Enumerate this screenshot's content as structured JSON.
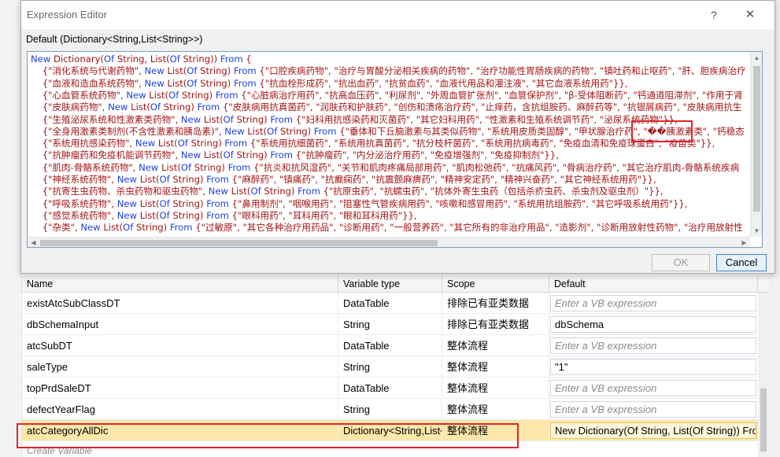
{
  "dialog": {
    "title": "Expression Editor",
    "help_label": "?",
    "close_label": "✕",
    "expression_label": "Default (Dictionary<String,List<String>>)",
    "ok_label": "OK",
    "cancel_label": "Cancel"
  },
  "code": {
    "lines": [
      [
        [
          "kw",
          "New"
        ],
        [
          "t",
          " Dictionary("
        ],
        [
          "kw",
          "Of"
        ],
        [
          "t",
          " String, List("
        ],
        [
          "kw",
          "Of"
        ],
        [
          "t",
          " String)) "
        ],
        [
          "kw",
          "From"
        ],
        [
          "t",
          " {"
        ]
      ],
      [
        [
          "t",
          "    {\"消化系统与代谢药物\", "
        ],
        [
          "kw",
          "New"
        ],
        [
          "t",
          " List("
        ],
        [
          "kw",
          "Of"
        ],
        [
          "t",
          " String) "
        ],
        [
          "kw",
          "From"
        ],
        [
          "t",
          " {\"口腔疾病药物\", \"治疗与胃酸分泌相关疾病的药物\", \"治疗功能性胃肠疾病的药物\", \"镇吐药和止呕药\", \"肝、胆疾病治疗"
        ]
      ],
      [
        [
          "t",
          "    {\"血液和造血系统药物\", "
        ],
        [
          "kw",
          "New"
        ],
        [
          "t",
          " List("
        ],
        [
          "kw",
          "Of"
        ],
        [
          "t",
          " String) "
        ],
        [
          "kw",
          "From"
        ],
        [
          "t",
          " {\"抗血栓形成药\", \"抗出血药\", \"抗贫血药\", \"血液代用品和灌注液\", \"其它血液系统用药\"}},"
        ]
      ],
      [
        [
          "t",
          "    {\"心血管系统药物\", "
        ],
        [
          "kw",
          "New"
        ],
        [
          "t",
          " List("
        ],
        [
          "kw",
          "Of"
        ],
        [
          "t",
          " String) "
        ],
        [
          "kw",
          "From"
        ],
        [
          "t",
          " {\"心脏病治疗用药\", \"抗高血压药\", \"利尿剂\", \"外周血管扩张剂\", \"血管保护剂\", \"β-受体阻断药\", \"钙通道阻滞剂\", \"作用于肾"
        ]
      ],
      [
        [
          "t",
          "    {\"皮肤病药物\", "
        ],
        [
          "kw",
          "New"
        ],
        [
          "t",
          " List("
        ],
        [
          "kw",
          "Of"
        ],
        [
          "t",
          " String) "
        ],
        [
          "kw",
          "From"
        ],
        [
          "t",
          " {\"皮肤病用抗真菌药\", \"润肤药和护肤药\", \"创伤和溃疡治疗药\", \"止痒药，含抗组胺药、麻醉药等\", \"抗银屑病药\", \"皮肤病用抗生"
        ]
      ],
      [
        [
          "t",
          "    {\"生殖泌尿系统和性激素类药物\", "
        ],
        [
          "kw",
          "New"
        ],
        [
          "t",
          " List("
        ],
        [
          "kw",
          "Of"
        ],
        [
          "t",
          " String) "
        ],
        [
          "kw",
          "From"
        ],
        [
          "t",
          " {\"妇科用抗感染药和灭菌药\", \"其它妇科用药\", \"性激素和生殖系统调节药\", \"泌尿系统药物\"}},"
        ]
      ],
      [
        [
          "t",
          "    {\"全身用激素类制剂(不含性激素和胰岛素)\", "
        ],
        [
          "kw",
          "New"
        ],
        [
          "t",
          " List("
        ],
        [
          "kw",
          "Of"
        ],
        [
          "t",
          " String) "
        ],
        [
          "kw",
          "From"
        ],
        [
          "t",
          " {\"垂体和下丘脑激素与其类似药物\", \"系统用皮质类固醇\", \"甲状腺治疗药\", \"��胰激素类\", \"钙稳态"
        ]
      ],
      [
        [
          "t",
          "    {\"系统用抗感染药物\", "
        ],
        [
          "kw",
          "New"
        ],
        [
          "t",
          " List("
        ],
        [
          "kw",
          "Of"
        ],
        [
          "t",
          " String) "
        ],
        [
          "kw",
          "From"
        ],
        [
          "t",
          " {\"系统用抗细菌药\", \"系统用抗真菌药\", \"抗分枝杆菌药\", \"系统用抗病毒药\", \"免疫血清和免疫球蛋白\", \"疫苗类\"}},"
        ]
      ],
      [
        [
          "t",
          "    {\"抗肿瘤药和免疫机能调节药物\", "
        ],
        [
          "kw",
          "New"
        ],
        [
          "t",
          " List("
        ],
        [
          "kw",
          "Of"
        ],
        [
          "t",
          " String) "
        ],
        [
          "kw",
          "From"
        ],
        [
          "t",
          " {\"抗肿瘤药\", \"内分泌治疗用药\", \"免疫增强剂\", \"免疫抑制剂\"}},"
        ]
      ],
      [
        [
          "t",
          "    {\"肌肉-骨骼系统药物\", "
        ],
        [
          "kw",
          "New"
        ],
        [
          "t",
          " List("
        ],
        [
          "kw",
          "Of"
        ],
        [
          "t",
          " String) "
        ],
        [
          "kw",
          "From"
        ],
        [
          "t",
          " {\"抗炎和抗风湿药\", \"关节和肌肉疼痛局部用药\", \"肌肉松弛药\", \"抗痛风药\", \"骨病治疗药\", \"其它治疗肌肉-骨骼系统疾病"
        ]
      ],
      [
        [
          "t",
          "    {\"神经系统药物\", "
        ],
        [
          "kw",
          "New"
        ],
        [
          "t",
          " List("
        ],
        [
          "kw",
          "Of"
        ],
        [
          "t",
          " String) "
        ],
        [
          "kw",
          "From"
        ],
        [
          "t",
          " {\"麻醉药\", \"镇痛药\", \"抗癫痫药\", \"抗震颤麻痹药\", \"精神安定药\", \"精神兴奋药\", \"其它神经系统用药\"}},"
        ]
      ],
      [
        [
          "t",
          "    {\"抗寄生虫药物、杀虫药物和驱虫药物\", "
        ],
        [
          "kw",
          "New"
        ],
        [
          "t",
          " List("
        ],
        [
          "kw",
          "Of"
        ],
        [
          "t",
          " String) "
        ],
        [
          "kw",
          "From"
        ],
        [
          "t",
          " {\"抗原虫药\", \"抗蠕虫药\", \"抗体外寄生虫药（包括杀疥虫药、杀虫剂及驱虫剂）\"}},"
        ]
      ],
      [
        [
          "t",
          "    {\"呼吸系统药物\", "
        ],
        [
          "kw",
          "New"
        ],
        [
          "t",
          " List("
        ],
        [
          "kw",
          "Of"
        ],
        [
          "t",
          " String) "
        ],
        [
          "kw",
          "From"
        ],
        [
          "t",
          " {\"鼻用制剂\", \"咽喉用药\", \"阻塞性气管疾病用药\", \"咳嗽和感冒用药\", \"系统用抗组胺药\", \"其它呼吸系统用药\"}},"
        ]
      ],
      [
        [
          "t",
          "    {\"感觉系统药物\", "
        ],
        [
          "kw",
          "New"
        ],
        [
          "t",
          " List("
        ],
        [
          "kw",
          "Of"
        ],
        [
          "t",
          " String) "
        ],
        [
          "kw",
          "From"
        ],
        [
          "t",
          " {\"眼科用药\", \"耳科用药\", \"眼和耳科用药\"}},"
        ]
      ],
      [
        [
          "t",
          "    {\"杂类\", "
        ],
        [
          "kw",
          "New"
        ],
        [
          "t",
          " List("
        ],
        [
          "kw",
          "Of"
        ],
        [
          "t",
          " String) "
        ],
        [
          "kw",
          "From"
        ],
        [
          "t",
          " {\"过敏原\", \"其它各种治疗用药品\", \"诊断用药\", \"一般营养药\", \"其它所有的非治疗用品\", \"造影剂\", \"诊断用放射性药物\", \"治疗用放射性"
        ]
      ]
    ]
  },
  "variables": {
    "headers": {
      "name": "Name",
      "type": "Variable type",
      "scope": "Scope",
      "default": "Default"
    },
    "rows": [
      {
        "name": "existAtcSubClassDT",
        "type": "DataTable",
        "scope": "排除已有亚类数据",
        "default": "Enter a VB expression",
        "hint": true
      },
      {
        "name": "dbSchemaInput",
        "type": "String",
        "scope": "排除已有亚类数据",
        "default": "dbSchema",
        "hint": false
      },
      {
        "name": "atcSubDT",
        "type": "DataTable",
        "scope": "整体流程",
        "default": "Enter a VB expression",
        "hint": true
      },
      {
        "name": "saleType",
        "type": "String",
        "scope": "整体流程",
        "default": "\"1\"",
        "hint": false
      },
      {
        "name": "topPrdSaleDT",
        "type": "DataTable",
        "scope": "整体流程",
        "default": "Enter a VB expression",
        "hint": true
      },
      {
        "name": "defectYearFlag",
        "type": "String",
        "scope": "整体流程",
        "default": "Enter a VB expression",
        "hint": true
      },
      {
        "name": "atcCategoryAllDic",
        "type": "Dictionary<String,List<String>>",
        "scope": "整体流程",
        "default": "New Dictionary(Of String, List(Of String)) From {",
        "hint": false,
        "selected": true
      }
    ],
    "create_label": "Create Variable"
  },
  "colors": {
    "keyword": "#1f3fe0",
    "highlight": "#e0242e",
    "selected_row": "#fde7a9"
  }
}
